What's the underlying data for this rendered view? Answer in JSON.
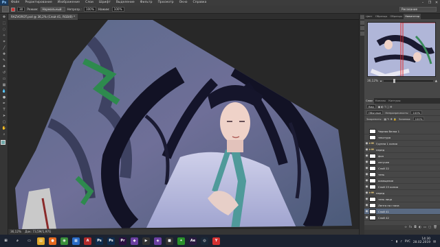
{
  "app": {
    "logo": "Ps",
    "menu": [
      "Файл",
      "Редактирование",
      "Изображение",
      "Слои",
      "Шрифт",
      "Выделение",
      "Фильтр",
      "Просмотр",
      "Окно",
      "Справка"
    ],
    "window_controls": [
      "–",
      "❐",
      "✕"
    ]
  },
  "options_bar": {
    "size_value": "30",
    "mode_label": "Режим:",
    "mode_value": "Нормальный",
    "opacity_label": "Непрозр.:",
    "opacity_value": "100%",
    "flow_label": "Нажим:",
    "flow_value": "100%",
    "workspace": "Рисование"
  },
  "document": {
    "tab": "RAZVOROT.psd @ 36,2% (Слой 41, RGB/8) *",
    "zoom_status": "36,12%",
    "doc_status": "Док: 73,5M/1,97G"
  },
  "right_panels": {
    "top_tabs": [
      "Цвет",
      "Образцы",
      "Образцы",
      "Навигатор"
    ],
    "active_top_tab": "Навигатор",
    "navigator_zoom": "36,12%",
    "layer_tabs": [
      "Слои",
      "Каналы",
      "Контуры"
    ],
    "active_layer_tab": "Слои",
    "kind_filter": "Вид",
    "blend_mode": "Обычные",
    "opacity_label": "Непрозрачность:",
    "opacity_value": "100%",
    "lock_label": "Закрепить:",
    "fill_label": "Заливка:",
    "fill_value": "100%"
  },
  "layers": [
    {
      "name": "Черная белка 1",
      "type": "layer",
      "visible": false,
      "selected": false
    },
    {
      "name": "текстура",
      "type": "layer",
      "visible": false,
      "selected": false
    },
    {
      "name": "Группа 1 копия",
      "type": "group",
      "visible": true,
      "selected": false
    },
    {
      "name": "перед",
      "type": "group",
      "visible": true,
      "selected": false
    },
    {
      "name": "фон",
      "type": "layer",
      "visible": true,
      "selected": false
    },
    {
      "name": "летучее",
      "type": "layer",
      "visible": true,
      "selected": false
    },
    {
      "name": "Слой 22",
      "type": "layer",
      "visible": true,
      "selected": false
    },
    {
      "name": "тень",
      "type": "layer",
      "visible": true,
      "selected": false
    },
    {
      "name": "освещение",
      "type": "layer",
      "visible": true,
      "selected": false
    },
    {
      "name": "Слой 23 копия",
      "type": "layer",
      "visible": true,
      "selected": false
    },
    {
      "name": "перед",
      "type": "group",
      "visible": true,
      "selected": false
    },
    {
      "name": "тень лицо",
      "type": "layer",
      "visible": true,
      "selected": false
    },
    {
      "name": "Лента на глаза",
      "type": "layer",
      "visible": true,
      "selected": false
    },
    {
      "name": "Слой 41",
      "type": "layer",
      "visible": true,
      "selected": true
    },
    {
      "name": "Слой 42",
      "type": "layer",
      "visible": true,
      "selected": false
    }
  ],
  "taskbar": {
    "apps": [
      {
        "icon": "windows-icon",
        "glyph": "⊞",
        "color": "#1b2230"
      },
      {
        "icon": "search-icon",
        "glyph": "⌕",
        "color": "#1b2230"
      },
      {
        "icon": "task-view-icon",
        "glyph": "▭",
        "color": "#1b2230"
      },
      {
        "icon": "explorer-icon",
        "glyph": "▤",
        "color": "#e0a82c"
      },
      {
        "icon": "firefox-icon",
        "glyph": "●",
        "color": "#e66a1f"
      },
      {
        "icon": "chrome-icon",
        "glyph": "◉",
        "color": "#3a8f3a"
      },
      {
        "icon": "store-icon",
        "glyph": "▦",
        "color": "#2a6bc5"
      },
      {
        "icon": "app-red-icon",
        "glyph": "A",
        "color": "#b22a2a"
      },
      {
        "icon": "photoshop-icon",
        "glyph": "Ps",
        "color": "#0f2c4d"
      },
      {
        "icon": "photoshop2-icon",
        "glyph": "Ps",
        "color": "#0f2c4d"
      },
      {
        "icon": "premiere-icon",
        "glyph": "Pr",
        "color": "#2b1040"
      },
      {
        "icon": "vs-icon",
        "glyph": "◆",
        "color": "#6a3fa0"
      },
      {
        "icon": "media-icon",
        "glyph": "▶",
        "color": "#333"
      },
      {
        "icon": "visual-studio-icon",
        "glyph": "◈",
        "color": "#6a3fa0"
      },
      {
        "icon": "app-dark-icon",
        "glyph": "■",
        "color": "#333"
      },
      {
        "icon": "app-green-icon",
        "glyph": "✦",
        "color": "#2a8f2a"
      },
      {
        "icon": "aftereffects-icon",
        "glyph": "Ae",
        "color": "#2a1a40"
      },
      {
        "icon": "steam-icon",
        "glyph": "◎",
        "color": "#1b2838"
      },
      {
        "icon": "app-yellow-icon",
        "glyph": "Y",
        "color": "#d43030"
      }
    ],
    "lang": "РУС",
    "time": "14:30",
    "date": "28.02.2019"
  }
}
